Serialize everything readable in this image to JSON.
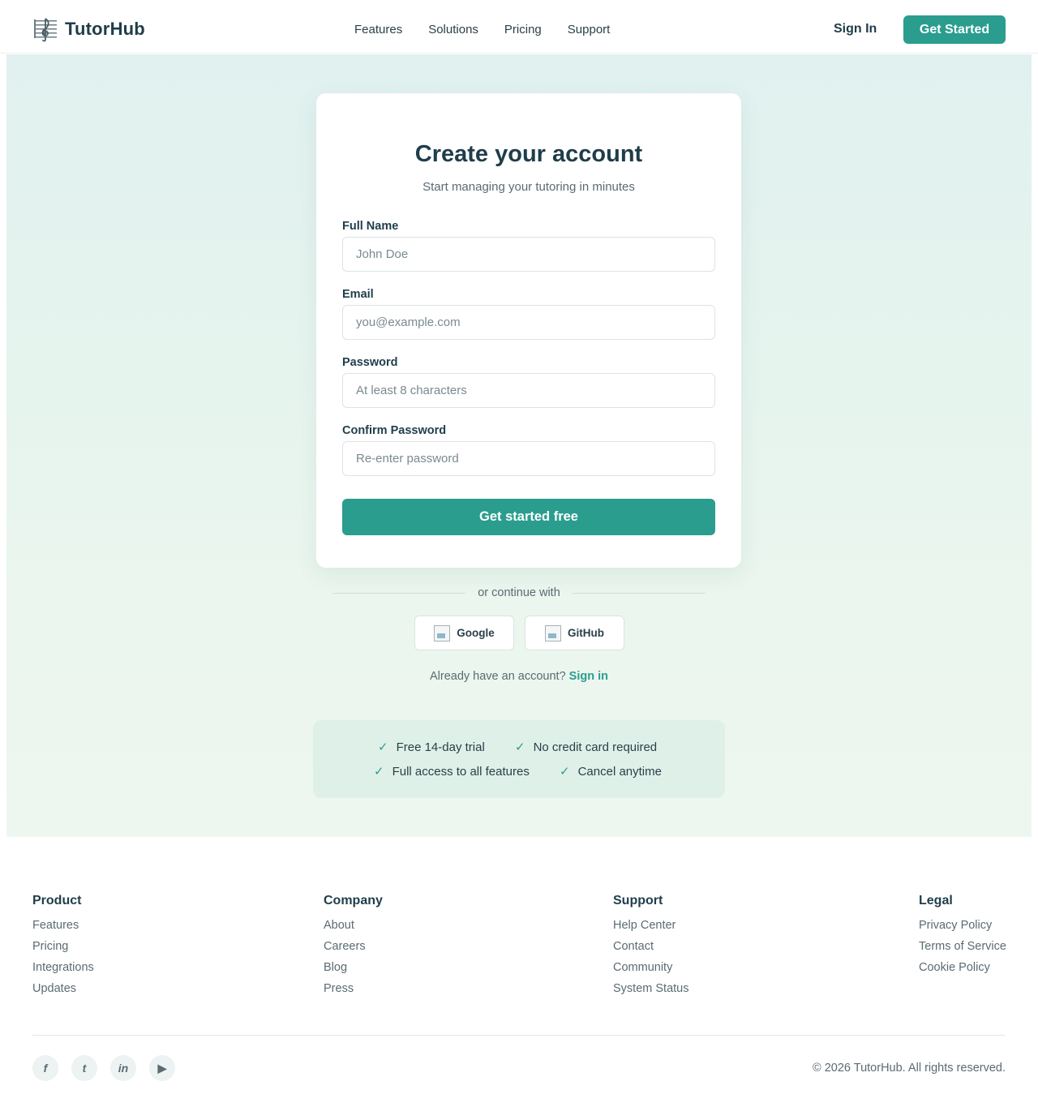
{
  "brand": {
    "name": "TutorHub",
    "icon": "music-note-icon"
  },
  "nav": {
    "items": [
      "Features",
      "Solutions",
      "Pricing",
      "Support"
    ]
  },
  "header": {
    "signin_label": "Sign In",
    "cta_label": "Get Started"
  },
  "card": {
    "title": "Create your account",
    "subtitle": "Start managing your tutoring in minutes",
    "fields": [
      {
        "label": "Full Name",
        "placeholder": "John Doe"
      },
      {
        "label": "Email",
        "placeholder": "you@example.com"
      },
      {
        "label": "Password",
        "placeholder": "At least 8 characters"
      },
      {
        "label": "Confirm Password",
        "placeholder": "Re-enter password"
      }
    ],
    "submit_label": "Get started free"
  },
  "oauth": {
    "divider_text": "or continue with",
    "providers": [
      "Google",
      "GitHub"
    ]
  },
  "signin_prompt": {
    "text": "Already have an account?",
    "link": "Sign in"
  },
  "benefits": [
    "Free 14-day trial",
    "No credit card required",
    "Full access to all features",
    "Cancel anytime"
  ],
  "footer": {
    "columns": [
      {
        "title": "Product",
        "links": [
          "Features",
          "Pricing",
          "Integrations",
          "Updates"
        ]
      },
      {
        "title": "Company",
        "links": [
          "About",
          "Careers",
          "Blog",
          "Press"
        ]
      },
      {
        "title": "Support",
        "links": [
          "Help Center",
          "Contact",
          "Community",
          "System Status"
        ]
      },
      {
        "title": "Legal",
        "links": [
          "Privacy Policy",
          "Terms of Service",
          "Cookie Policy"
        ]
      }
    ],
    "social": [
      "f",
      "t",
      "in",
      "▶"
    ],
    "copyright": "© 2026 TutorHub. All rights reserved."
  },
  "colors": {
    "accent": "#2a9d8f",
    "text": "#1f3d4a",
    "muted": "#5a6b72"
  }
}
